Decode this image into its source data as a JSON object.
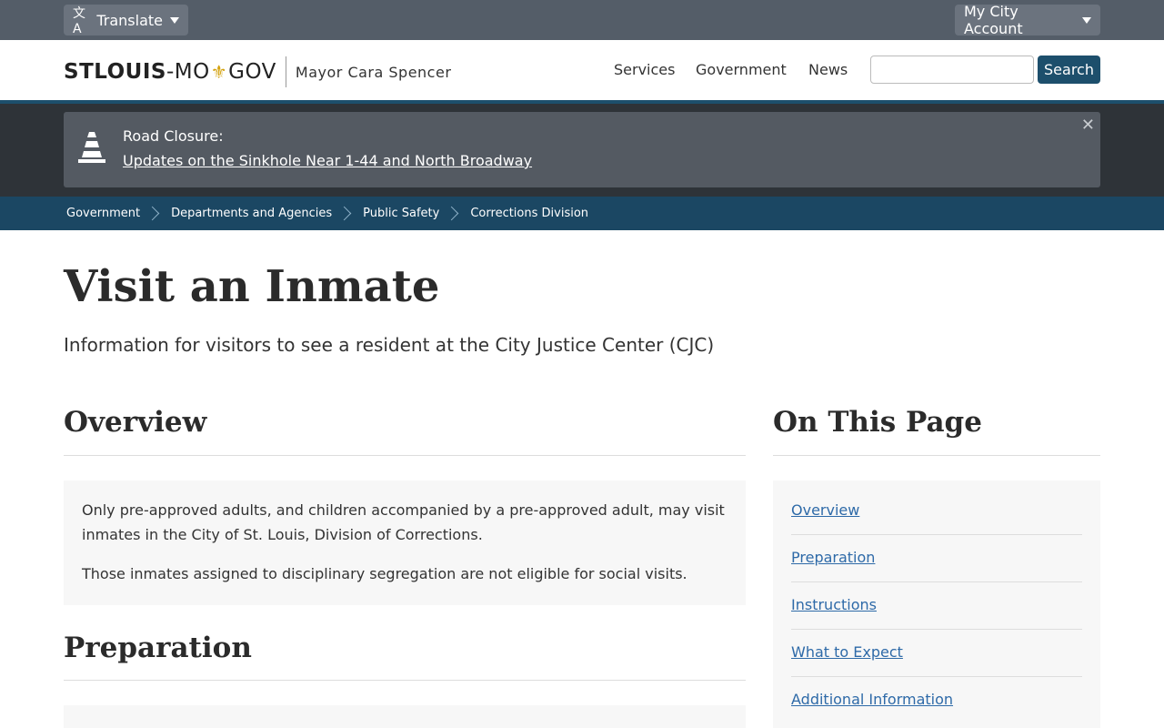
{
  "topbar": {
    "translate_label": "Translate",
    "account_label": "My City Account"
  },
  "header": {
    "logo_bold": "STLOUIS",
    "logo_dash": "-MO",
    "logo_gov": "GOV",
    "mayor": "Mayor Cara Spencer",
    "nav": [
      "Services",
      "Government",
      "News"
    ],
    "search_placeholder": "",
    "search_label": "Search"
  },
  "alert": {
    "title": "Road Closure:",
    "link": "Updates on the Sinkhole Near 1-44 and North Broadway",
    "close": "✕"
  },
  "breadcrumb": [
    "Government",
    "Departments and Agencies",
    "Public Safety",
    "Corrections Division"
  ],
  "main": {
    "title": "Visit an Inmate",
    "subtitle": "Information for visitors to see a resident at the City Justice Center (CJC)",
    "overview": {
      "heading": "Overview",
      "p1": "Only pre-approved adults, and children accompanied by a pre-approved adult, may visit inmates in the City of St. Louis, Division of Corrections.",
      "p2": "Those inmates assigned to disciplinary segregation are not eligible for social visits."
    },
    "preparation": {
      "heading": "Preparation"
    }
  },
  "toc": {
    "heading": "On This Page",
    "links": [
      "Overview",
      "Preparation",
      "Instructions",
      "What to Expect",
      "Additional Information"
    ]
  },
  "colors": {
    "brand_blue": "#1d4f6c",
    "link": "#2e6aa8",
    "fleur": "#d4a20e"
  }
}
